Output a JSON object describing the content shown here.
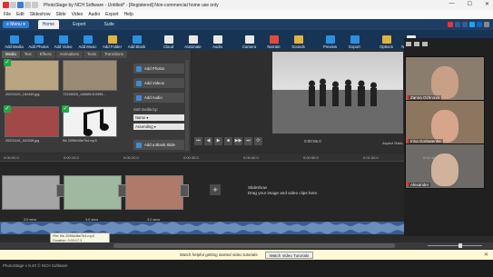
{
  "window": {
    "title": "PhotoStage by NCH Software - Untitled* - [Registered] Non-commercial home use only",
    "controls": [
      "—",
      "☐",
      "✕"
    ]
  },
  "menubar": [
    "File",
    "Edit",
    "Slideshow",
    "Slide",
    "Video",
    "Audio",
    "Export",
    "Help"
  ],
  "ribbon": {
    "menu_label": "≡ Menu ▾",
    "tabs": [
      "Home",
      "Export",
      "Suite"
    ],
    "active_tab": "Home"
  },
  "toolbar": [
    {
      "label": "Add Media",
      "icon": "add-media-icon",
      "color": "#2c8fe0"
    },
    {
      "label": "Add Photos",
      "icon": "add-photos-icon",
      "color": "#2c8fe0"
    },
    {
      "label": "Add Video",
      "icon": "add-video-icon",
      "color": "#2c8fe0"
    },
    {
      "label": "Add Music",
      "icon": "add-music-icon",
      "color": "#2c8fe0"
    },
    {
      "label": "Add Folder",
      "icon": "add-folder-icon",
      "color": "#e0b43c"
    },
    {
      "label": "Add Blank",
      "icon": "add-blank-icon",
      "color": "#2c8fe0"
    },
    {
      "label": "Cloud",
      "icon": "cloud-icon",
      "color": "#e9e9e9"
    },
    {
      "label": "Automate",
      "icon": "automate-icon",
      "color": "#e9e9e9"
    },
    {
      "label": "Audio",
      "icon": "audio-icon",
      "color": "#e9e9e9"
    },
    {
      "label": "Camera",
      "icon": "camera-icon",
      "color": "#e9e9e9"
    },
    {
      "label": "Narrate",
      "icon": "narrate-icon",
      "color": "#e04b3c"
    },
    {
      "label": "Sounds",
      "icon": "sounds-icon",
      "color": "#e0b43c"
    },
    {
      "label": "Preview",
      "icon": "preview-icon",
      "color": "#2c8fe0"
    },
    {
      "label": "Export",
      "icon": "export-icon",
      "color": "#2c8fe0"
    },
    {
      "label": "Options",
      "icon": "options-icon",
      "color": "#e0b43c"
    },
    {
      "label": "NCH Suite",
      "icon": "nch-suite-icon",
      "color": "#e9e9e9"
    }
  ],
  "media_tabs": [
    "Media",
    "Text",
    "Effects",
    "Animations",
    "Tools",
    "Transitions"
  ],
  "media_active_tab": "Media",
  "media_items": [
    {
      "label": "20201120_162449.jpg",
      "color": "#b9a582"
    },
    {
      "label": "72228325_145881319355...",
      "color": "#9b8a74"
    },
    {
      "label": "20201115_162345.jpg",
      "color": "#a34848"
    },
    {
      "label": "file 2096b36e7b4.mp3",
      "color": "#f2f2f2"
    }
  ],
  "media_actions": [
    "Add Photos",
    "Add Videos",
    "Add Audio",
    "Add a Blank Slide"
  ],
  "sort": {
    "label": "Sort media by:",
    "field": "Name ▾",
    "order": "Ascending ▾"
  },
  "player": {
    "buttons": [
      "⏮",
      "◀",
      "▶",
      "■",
      "▶▶",
      "⏭",
      "⟳"
    ],
    "timecode": "0:00:06.0",
    "aspect_label": "Aspect Ratio"
  },
  "call": {
    "participants": [
      {
        "name": "Zanna Ozhnova",
        "bg": "#8a7d6e",
        "face": "#c99f86"
      },
      {
        "name": "Irina Gorbatenko",
        "bg": "#8c7660",
        "face": "#d7a58c"
      },
      {
        "name": "Alexander",
        "bg": "#6d6a68",
        "face": "#d1b29c"
      }
    ]
  },
  "timeline": {
    "ruler_ticks": [
      "0:00:00.0",
      "0:00:10.0",
      "0:00:20.0",
      "0:00:30.0",
      "0:00:40.0",
      "0:00:50.0",
      "0:01:00.0",
      "0:01:10.0"
    ],
    "clips": [
      {
        "label": "3.0 secs",
        "color": "#a5a5a5"
      },
      {
        "label": "3.0 secs",
        "color": "#9fb8a0"
      },
      {
        "label": "3.0 secs",
        "color": "#b07a6a"
      }
    ],
    "hint_title": "Slideshow",
    "hint_text": "Drag your image and video clips here.",
    "add_label": "+"
  },
  "tooltip": {
    "line1": "File: file 2096b36e7b4.mp3",
    "line2": "Duration: 0:03:17.3"
  },
  "infobar": {
    "message": "Watch helpful getting started video tutorials",
    "button": "Watch Video Tutorials",
    "close": "✕"
  },
  "statusbar": {
    "text": "PhotoStage v 8.40 © NCH Software"
  }
}
